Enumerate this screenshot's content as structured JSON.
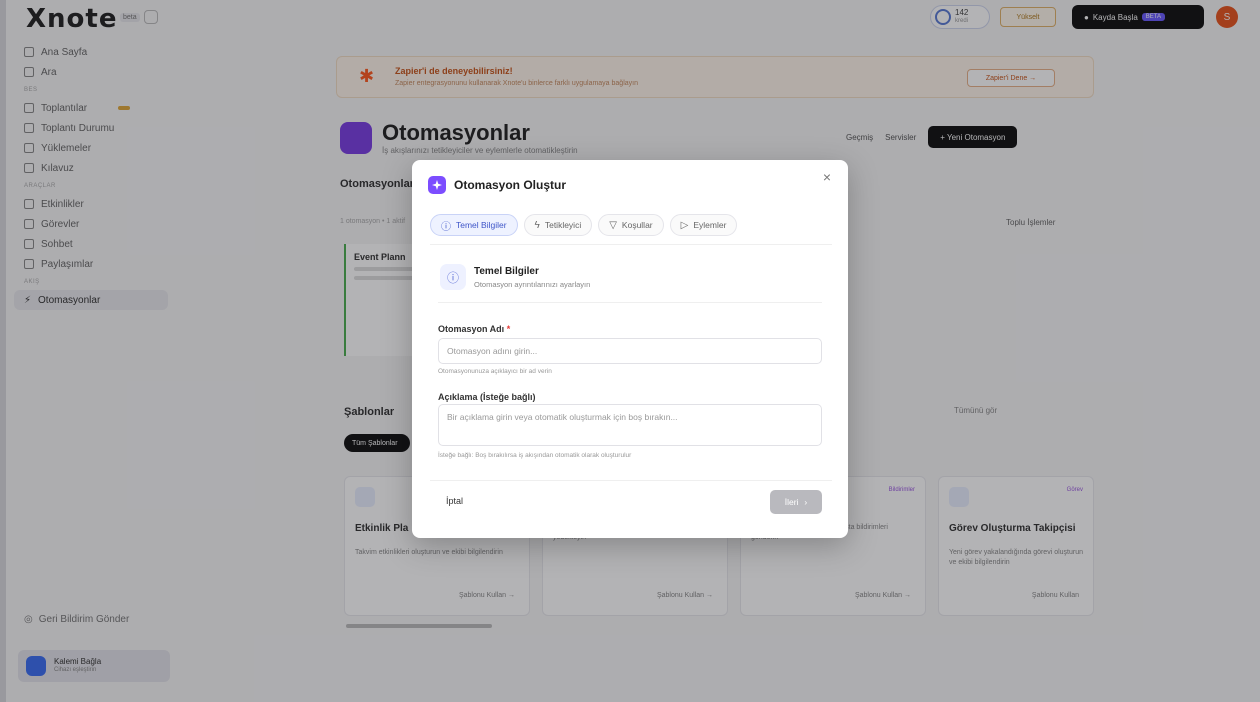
{
  "app": {
    "logo": "Xnote",
    "logo_badge": "beta",
    "credits": "142",
    "credits_sub": "kredi",
    "upgrade": "Yükselt",
    "record_btn": "Kayda Başla",
    "record_badge": "BETA",
    "avatar_initial": "S"
  },
  "sidebar": {
    "top": [
      {
        "label": "Ana Sayfa",
        "icon": "home-icon"
      },
      {
        "label": "Ara",
        "icon": "search-icon"
      }
    ],
    "section1": "BES",
    "mid": [
      {
        "label": "Toplantılar",
        "icon": "calendar-icon"
      },
      {
        "label": "Toplantı Durumu",
        "icon": "calendar-icon"
      },
      {
        "label": "Yüklemeler",
        "icon": "upload-icon"
      },
      {
        "label": "Kılavuz",
        "icon": "book-icon"
      }
    ],
    "section2": "ARAÇLAR",
    "tools": [
      {
        "label": "Etkinlikler",
        "icon": "grid-icon"
      },
      {
        "label": "Görevler",
        "icon": "check-icon"
      },
      {
        "label": "Sohbet",
        "icon": "chat-icon"
      },
      {
        "label": "Paylaşımlar",
        "icon": "share-icon"
      }
    ],
    "section3": "AKIŞ",
    "active_item": "Otomasyonlar",
    "feedback": "Geri Bildirim Gönder",
    "connect_title": "Kalemi Bağla",
    "connect_sub": "Cihazı eşleştirin"
  },
  "banner": {
    "title": "Zapier'i de deneyebilirsiniz!",
    "text": "Zapier entegrasyonunu kullanarak Xnote'u binlerce farklı uygulamaya bağlayın",
    "button": "Zapier'i Dene →"
  },
  "page": {
    "title": "Otomasyonlar",
    "subtitle": "İş akışlarınızı tetikleyiciler ve eylemlerle otomatikleştirin",
    "action_history": "Geçmiş",
    "action_services": "Servisler",
    "action_new": "+ Yeni Otomasyon",
    "section_title": "Otomasyonlar",
    "section_count": "1 otomasyon • 1 aktif",
    "bulk": "Toplu İşlemler",
    "event_card_title": "Event Plann",
    "templates_title": "Şablonlar",
    "templates_pager": "Tümünü gör",
    "templates_chip": "Tüm Şablonlar",
    "templates": [
      {
        "title": "Etkinlik Pla",
        "desc": "Takvim etkinlikleri oluşturun ve ekibi bilgilendirin",
        "use": "Şablonu Kullan →",
        "badge": ""
      },
      {
        "title": "",
        "desc": "Toplantı notlarını otomatik olarak Google Drive'a yedekleyin",
        "use": "Şablonu Kullan →",
        "badge": ""
      },
      {
        "title": "",
        "desc": "Acil durumda ilgili kişilere e-posta bildirimleri gönderin",
        "use": "Şablonu Kullan →",
        "badge": "Bildirimler"
      },
      {
        "title": "Görev Oluşturma Takipçisi",
        "desc": "Yeni görev yakalandığında görevi oluşturun ve ekibi bilgilendirin",
        "use": "Şablonu Kullan",
        "badge": "Görev"
      }
    ]
  },
  "modal": {
    "title": "Otomasyon Oluştur",
    "tabs": [
      {
        "label": "Temel Bilgiler",
        "icon": "info-icon",
        "active": true
      },
      {
        "label": "Tetikleyici",
        "icon": "zap-icon",
        "active": false
      },
      {
        "label": "Koşullar",
        "icon": "filter-icon",
        "active": false
      },
      {
        "label": "Eylemler",
        "icon": "play-icon",
        "active": false
      }
    ],
    "step_title": "Temel Bilgiler",
    "step_sub": "Otomasyon ayrıntılarınızı ayarlayın",
    "name_label": "Otomasyon Adı",
    "name_required": "*",
    "name_placeholder": "Otomasyon adını girin...",
    "name_help": "Otomasyonunuza açıklayıcı bir ad verin",
    "desc_label": "Açıklama (İsteğe bağlı)",
    "desc_placeholder": "Bir açıklama girin veya otomatik oluşturmak için boş bırakın...",
    "desc_help": "İsteğe bağlı: Boş bırakılırsa iş akışından otomatik olarak oluşturulur",
    "cancel": "İptal",
    "next": "İleri",
    "next_arrow": "›"
  },
  "colors": {
    "accent": "#7c4dff",
    "tab_active": "#3f56c9",
    "required": "#e53935",
    "next_disabled": "#b9b9be"
  }
}
